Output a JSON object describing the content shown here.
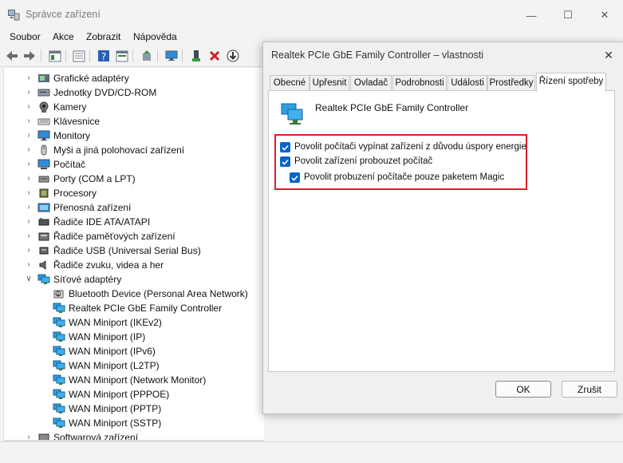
{
  "window": {
    "title": "Správce zařízení",
    "controls": {
      "minimize": "—",
      "maximize": "☐",
      "close": "✕"
    }
  },
  "menu": [
    "Soubor",
    "Akce",
    "Zobrazit",
    "Nápověda"
  ],
  "toolbar_icons": [
    "back-arrow-icon",
    "forward-arrow-icon",
    "properties-icon",
    "list-icon",
    "help-icon",
    "view-icon",
    "update-driver-icon",
    "monitor-icon",
    "enable-device-icon",
    "uninstall-icon",
    "download-icon"
  ],
  "tree": [
    {
      "label": "Grafické adaptéry",
      "expanded": false,
      "icon": "display-adapter-icon"
    },
    {
      "label": "Jednotky DVD/CD-ROM",
      "expanded": false,
      "icon": "dvd-drive-icon"
    },
    {
      "label": "Kamery",
      "expanded": false,
      "icon": "camera-icon"
    },
    {
      "label": "Klávesnice",
      "expanded": false,
      "icon": "keyboard-icon"
    },
    {
      "label": "Monitory",
      "expanded": false,
      "icon": "monitor-icon"
    },
    {
      "label": "Myši a jiná polohovací zařízení",
      "expanded": false,
      "icon": "mouse-icon"
    },
    {
      "label": "Počítač",
      "expanded": false,
      "icon": "computer-icon"
    },
    {
      "label": "Porty (COM a LPT)",
      "expanded": false,
      "icon": "port-icon"
    },
    {
      "label": "Procesory",
      "expanded": false,
      "icon": "processor-icon"
    },
    {
      "label": "Přenosná zařízení",
      "expanded": false,
      "icon": "portable-device-icon"
    },
    {
      "label": "Řadiče IDE ATA/ATAPI",
      "expanded": false,
      "icon": "ide-controller-icon"
    },
    {
      "label": "Řadiče paměťových zařízení",
      "expanded": false,
      "icon": "storage-controller-icon"
    },
    {
      "label": "Řadiče USB (Universal Serial Bus)",
      "expanded": false,
      "icon": "usb-icon"
    },
    {
      "label": "Řadiče zvuku, videa a her",
      "expanded": false,
      "icon": "speaker-icon"
    },
    {
      "label": "Síťové adaptéry",
      "expanded": true,
      "icon": "network-adapter-icon"
    }
  ],
  "network_children": [
    {
      "label": "Bluetooth Device (Personal Area Network)",
      "icon": "bluetooth-network-icon"
    },
    {
      "label": "Realtek PCIe GbE Family Controller",
      "icon": "network-adapter-icon"
    },
    {
      "label": "WAN Miniport (IKEv2)",
      "icon": "network-adapter-icon"
    },
    {
      "label": "WAN Miniport (IP)",
      "icon": "network-adapter-icon"
    },
    {
      "label": "WAN Miniport (IPv6)",
      "icon": "network-adapter-icon"
    },
    {
      "label": "WAN Miniport (L2TP)",
      "icon": "network-adapter-icon"
    },
    {
      "label": "WAN Miniport (Network Monitor)",
      "icon": "network-adapter-icon"
    },
    {
      "label": "WAN Miniport (PPPOE)",
      "icon": "network-adapter-icon"
    },
    {
      "label": "WAN Miniport (PPTP)",
      "icon": "network-adapter-icon"
    },
    {
      "label": "WAN Miniport (SSTP)",
      "icon": "network-adapter-icon"
    }
  ],
  "tree_last": {
    "label": "Softwarová zařízení",
    "expanded": false
  },
  "dialog": {
    "title": "Realtek PCIe GbE Family Controller – vlastnosti",
    "close": "✕",
    "tabs": [
      "Obecné",
      "Upřesnit",
      "Ovladač",
      "Podrobnosti",
      "Události",
      "Prostředky",
      "Řízení spotřeby"
    ],
    "active_tab": "Řízení spotřeby",
    "device_name": "Realtek PCIe GbE Family Controller",
    "options": [
      {
        "label": "Povolit počítači vypínat zařízení z důvodu úspory energie",
        "checked": true
      },
      {
        "label": "Povolit zařízení probouzet počítač",
        "checked": true
      },
      {
        "label": "Povolit probuzení počítače pouze paketem Magic",
        "checked": true
      }
    ],
    "ok_label": "OK",
    "cancel_label": "Zrušit"
  },
  "colors": {
    "accent": "#0a64c8",
    "highlight_border": "#d81f2a"
  }
}
